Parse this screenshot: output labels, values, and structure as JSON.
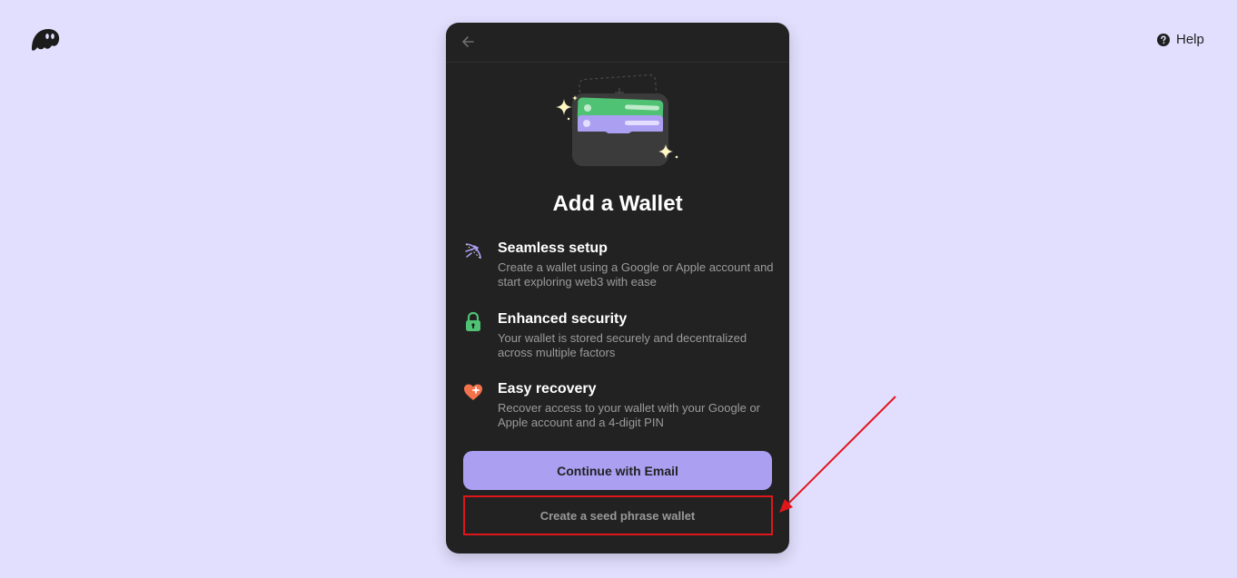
{
  "header": {
    "logo_icon": "phantom-ghost-icon",
    "help_label": "Help",
    "help_icon": "question-circle-icon"
  },
  "card": {
    "back_icon": "arrow-left-icon",
    "hero_icon": "wallet-illustration",
    "title": "Add a Wallet",
    "features": [
      {
        "icon": "bow-arrow-icon",
        "title": "Seamless setup",
        "desc": "Create a wallet using a Google or Apple account and start exploring web3 with ease"
      },
      {
        "icon": "padlock-icon",
        "title": "Enhanced security",
        "desc": "Your wallet is stored securely and decentralized across multiple factors"
      },
      {
        "icon": "heart-plus-icon",
        "title": "Easy recovery",
        "desc": "Recover access to your wallet with your Google or Apple account and a 4-digit PIN"
      }
    ],
    "primary_button": "Continue with Email",
    "secondary_button": "Create a seed phrase wallet"
  },
  "colors": {
    "page_bg": "#e2dffe",
    "card_bg": "#222222",
    "accent": "#ab9ff2",
    "annotation": "#e0161b"
  }
}
